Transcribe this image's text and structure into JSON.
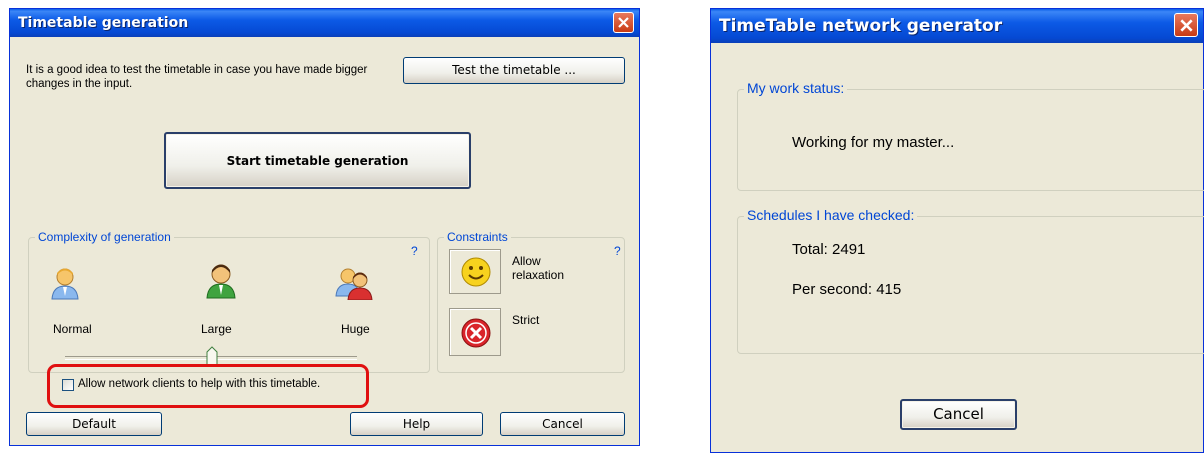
{
  "left_dialog": {
    "title": "Timetable generation",
    "info_text": "It is a good idea to test the timetable in case you have made bigger changes in the input.",
    "test_button": "Test the timetable ...",
    "start_button": "Start timetable generation",
    "complexity": {
      "legend": "Complexity of generation",
      "help": "?",
      "options": [
        {
          "label": "Normal",
          "icon": "user-icon"
        },
        {
          "label": "Large",
          "icon": "user-icon"
        },
        {
          "label": "Huge",
          "icon": "users-icon"
        }
      ],
      "selected": "Large"
    },
    "constraints": {
      "legend": "Constraints",
      "help": "?",
      "allow_label": "Allow relaxation",
      "strict_label": "Strict"
    },
    "network_checkbox": {
      "label": "Allow network clients to help with this timetable.",
      "checked": false,
      "highlight_color": "#e01010"
    },
    "buttons": {
      "default": "Default",
      "help": "Help",
      "cancel": "Cancel"
    }
  },
  "right_dialog": {
    "title": "TimeTable network generator",
    "status_legend": "My work status:",
    "status_text": "Working for my master...",
    "schedules_legend": "Schedules I have checked:",
    "total": "Total: 2491",
    "per_second": "Per second: 415",
    "cancel": "Cancel"
  },
  "colors": {
    "title_blue": "#0a5ee8",
    "legend_blue": "#0046d5",
    "dialog_bg": "#ece9d8"
  }
}
